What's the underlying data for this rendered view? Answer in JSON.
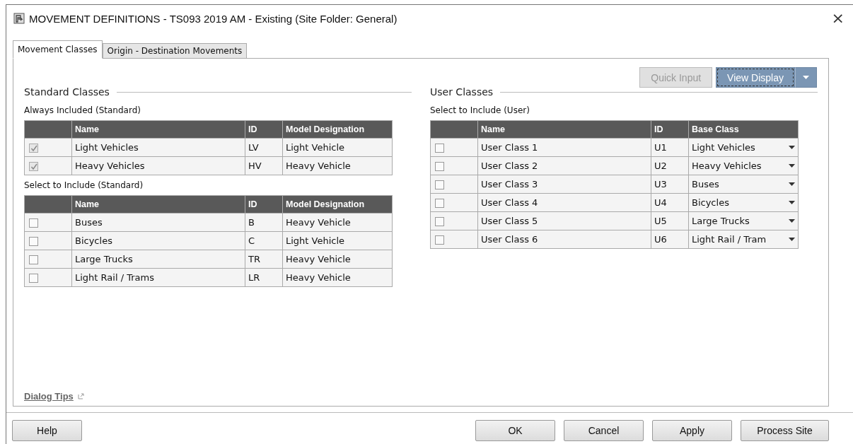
{
  "window": {
    "title": "MOVEMENT DEFINITIONS - TS093 2019 AM - Existing (Site Folder: General)",
    "close": "×"
  },
  "tabs": [
    {
      "label": "Movement Classes",
      "selected": true
    },
    {
      "label": "Origin - Destination Movements",
      "selected": false
    }
  ],
  "toolbar": {
    "quick_input": {
      "label": "Quick Input",
      "disabled": true
    },
    "view_display": {
      "label": "View Display",
      "focused": true
    }
  },
  "standard_classes": {
    "heading": "Standard Classes",
    "always_included": {
      "label": "Always Included (Standard)",
      "columns": [
        "Name",
        "ID",
        "Model Designation"
      ],
      "rows": [
        {
          "checked": true,
          "disabled": true,
          "name": "Light Vehicles",
          "id": "LV",
          "model": "Light Vehicle"
        },
        {
          "checked": true,
          "disabled": true,
          "name": "Heavy Vehicles",
          "id": "HV",
          "model": "Heavy Vehicle"
        }
      ]
    },
    "select_to_include": {
      "label": "Select to Include (Standard)",
      "columns": [
        "Name",
        "ID",
        "Model Designation"
      ],
      "rows": [
        {
          "checked": false,
          "disabled": false,
          "name": "Buses",
          "id": "B",
          "model": "Heavy Vehicle"
        },
        {
          "checked": false,
          "disabled": false,
          "name": "Bicycles",
          "id": "C",
          "model": "Light Vehicle"
        },
        {
          "checked": false,
          "disabled": false,
          "name": "Large Trucks",
          "id": "TR",
          "model": "Heavy Vehicle"
        },
        {
          "checked": false,
          "disabled": false,
          "name": "Light Rail / Trams",
          "id": "LR",
          "model": "Heavy Vehicle"
        }
      ]
    }
  },
  "user_classes": {
    "heading": "User Classes",
    "label": "Select to Include (User)",
    "columns": [
      "Name",
      "ID",
      "Base Class"
    ],
    "rows": [
      {
        "checked": false,
        "name": "User Class 1",
        "id": "U1",
        "base_class": "Light Vehicles"
      },
      {
        "checked": false,
        "name": "User Class 2",
        "id": "U2",
        "base_class": "Heavy Vehicles"
      },
      {
        "checked": false,
        "name": "User Class 3",
        "id": "U3",
        "base_class": "Buses"
      },
      {
        "checked": false,
        "name": "User Class 4",
        "id": "U4",
        "base_class": "Bicycles"
      },
      {
        "checked": false,
        "name": "User Class 5",
        "id": "U5",
        "base_class": "Large Trucks"
      },
      {
        "checked": false,
        "name": "User Class 6",
        "id": "U6",
        "base_class": "Light Rail / Tram"
      }
    ]
  },
  "dialog_tips": "Dialog Tips",
  "footer": {
    "left": [
      "Help"
    ],
    "right": [
      "OK",
      "Cancel",
      "Apply",
      "Process Site"
    ]
  }
}
